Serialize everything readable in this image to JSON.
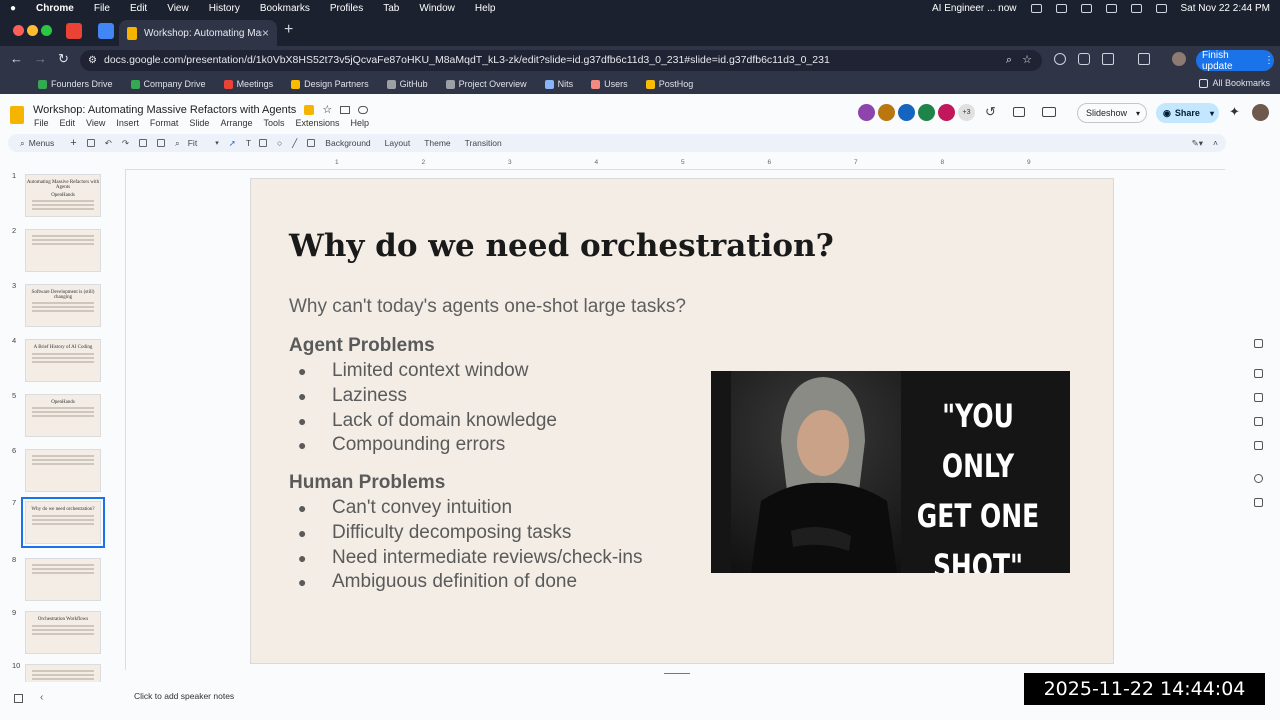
{
  "menubar": {
    "apple": "",
    "items": [
      "Chrome",
      "File",
      "Edit",
      "View",
      "History",
      "Bookmarks",
      "Profiles",
      "Tab",
      "Window",
      "Help"
    ],
    "ai_status": "AI Engineer ... now",
    "datetime": "Sat Nov 22  2:44 PM"
  },
  "browser": {
    "tab_title": "Workshop: Automating Massi",
    "url": "docs.google.com/presentation/d/1k0VbX8HS52t73v5jQcvaFe87oHKU_M8aMqdT_kL3-zk/edit?slide=id.g37dfb6c11d3_0_231#slide=id.g37dfb6c11d3_0_231",
    "finish_update": "Finish update",
    "bookmarks": [
      {
        "label": "Founders Drive",
        "color": "#34a853"
      },
      {
        "label": "Company Drive",
        "color": "#34a853"
      },
      {
        "label": "Meetings",
        "color": "#ea4335"
      },
      {
        "label": "Design Partners",
        "color": "#fbbc04"
      },
      {
        "label": "GitHub",
        "color": "#9aa0a6"
      },
      {
        "label": "Project Overview",
        "color": "#9aa0a6"
      },
      {
        "label": "Nits",
        "color": "#8ab4f8"
      },
      {
        "label": "Users",
        "color": "#f28b82"
      },
      {
        "label": "PostHog",
        "color": "#fbbc04"
      }
    ],
    "all_bookmarks": "All Bookmarks"
  },
  "app": {
    "doc_title": "Workshop: Automating Massive Refactors with Agents",
    "menus": [
      "File",
      "Edit",
      "View",
      "Insert",
      "Format",
      "Slide",
      "Arrange",
      "Tools",
      "Extensions",
      "Help"
    ],
    "collaborators_extra": "+3",
    "slideshow": "Slideshow",
    "share": "Share",
    "toolbar": {
      "menus": "Menus",
      "zoom": "Fit",
      "background": "Background",
      "layout": "Layout",
      "theme": "Theme",
      "transition": "Transition"
    },
    "ruler_ticks": [
      "1",
      "2",
      "3",
      "4",
      "5",
      "6",
      "7",
      "8",
      "9"
    ],
    "speaker_notes": "Click to add speaker notes"
  },
  "filmstrip": [
    {
      "num": "1",
      "title": "Automating Massive Refactors with Agents",
      "sub": "OpenHands"
    },
    {
      "num": "2",
      "title": "",
      "sub": ""
    },
    {
      "num": "3",
      "title": "",
      "sub": "Software Development is (still) changing"
    },
    {
      "num": "4",
      "title": "A Brief History of AI Coding",
      "sub": ""
    },
    {
      "num": "5",
      "title": "",
      "sub": "OpenHands"
    },
    {
      "num": "6",
      "title": "",
      "sub": ""
    },
    {
      "num": "7",
      "title": "Why do we need orchestration?",
      "sub": ""
    },
    {
      "num": "8",
      "title": "",
      "sub": ""
    },
    {
      "num": "9",
      "title": "Orchestration Workflows",
      "sub": ""
    },
    {
      "num": "10",
      "title": "",
      "sub": ""
    }
  ],
  "slide": {
    "title": "Why do we need orchestration?",
    "subtitle": "Why can't today's agents one-shot large tasks?",
    "agent_heading": "Agent Problems",
    "agent_items": [
      "Limited context window",
      "Laziness",
      "Lack of domain knowledge",
      "Compounding errors"
    ],
    "human_heading": "Human Problems",
    "human_items": [
      "Can't convey intuition",
      "Difficulty decomposing tasks",
      "Need intermediate reviews/check-ins",
      "Ambiguous definition of done"
    ],
    "meme_quote": "\"YOU ONLY GET ONE SHOT\""
  },
  "overlay_timestamp": "2025-11-22  14:44:04"
}
